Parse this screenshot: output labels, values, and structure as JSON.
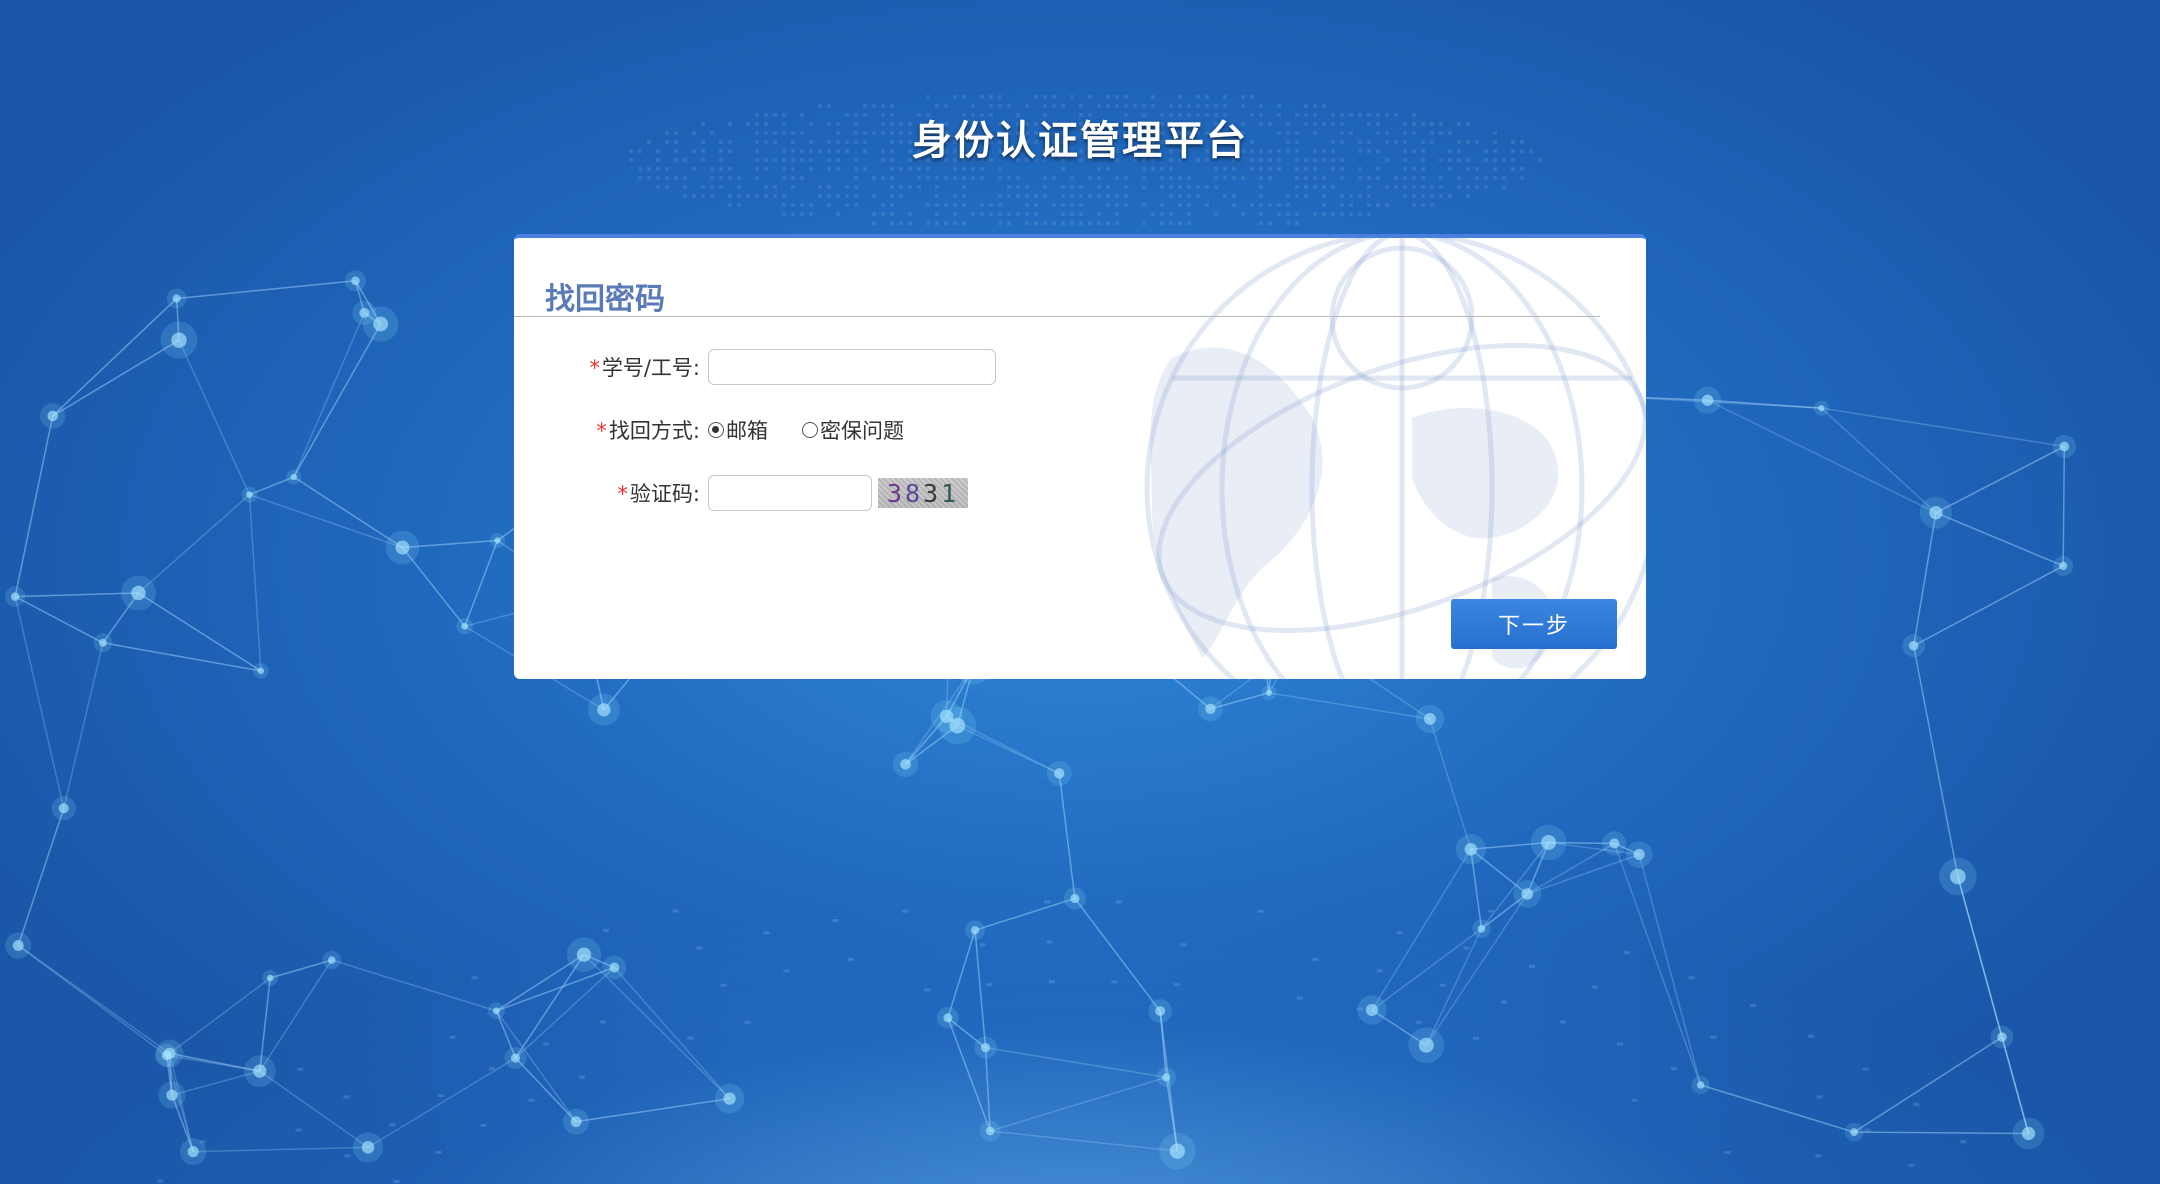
{
  "header": {
    "title": "身份认证管理平台"
  },
  "card": {
    "title": "找回密码",
    "fields": {
      "id": {
        "required_mark": "*",
        "label": "学号/工号:",
        "value": "",
        "placeholder": ""
      },
      "method": {
        "required_mark": "*",
        "label": "找回方式:",
        "options": [
          "邮箱",
          "密保问题"
        ],
        "selected": "邮箱"
      },
      "captcha": {
        "required_mark": "*",
        "label": "验证码:",
        "value": "",
        "placeholder": "",
        "image_text": [
          "3",
          "8",
          "3",
          "1"
        ]
      }
    },
    "next_label": "下一步"
  },
  "colors": {
    "background": "#2068bd",
    "accent": "#2f7ad8",
    "card_title": "#5a7ab8",
    "required": "#e33333"
  }
}
